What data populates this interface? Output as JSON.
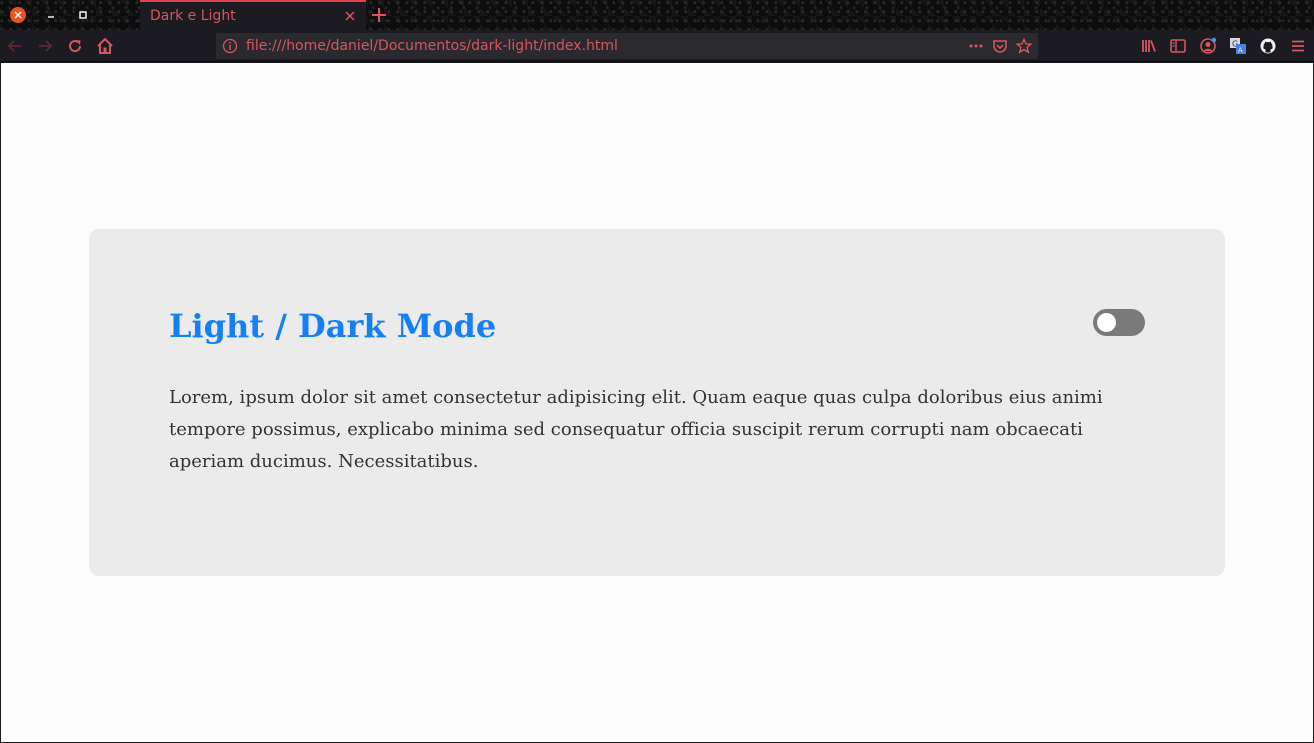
{
  "browser": {
    "tab": {
      "title": "Dark e Light"
    },
    "url": "file:///home/daniel/Documentos/dark-light/index.html",
    "accent_color": "#d65561",
    "icons": {
      "window_close": "close-icon",
      "window_minimize": "minimize-icon",
      "window_maximize": "maximize-icon",
      "tab_close": "close-icon",
      "new_tab": "plus-icon",
      "back": "arrow-left-icon",
      "forward": "arrow-right-icon",
      "reload": "reload-icon",
      "home": "home-icon",
      "site_info": "info-icon",
      "page_actions": "ellipsis-icon",
      "pocket": "pocket-icon",
      "bookmark": "star-icon",
      "library": "library-icon",
      "sidebar": "sidebar-icon",
      "account": "account-icon",
      "translate": "translate-icon",
      "github": "github-icon",
      "menu": "hamburger-icon"
    }
  },
  "page": {
    "title": "Light / Dark Mode",
    "title_color": "#1480f4",
    "body_text": "Lorem, ipsum dolor sit amet consectetur adipisicing elit. Quam eaque quas culpa doloribus eius animi tempore possimus, explicabo minima sed consequatur officia suscipit rerum corrupti nam obcaecati aperiam ducimus. Necessitatibus.",
    "card_background": "#ebebeb",
    "page_background": "#fcfcfc",
    "theme_toggle": {
      "state": "off"
    }
  }
}
